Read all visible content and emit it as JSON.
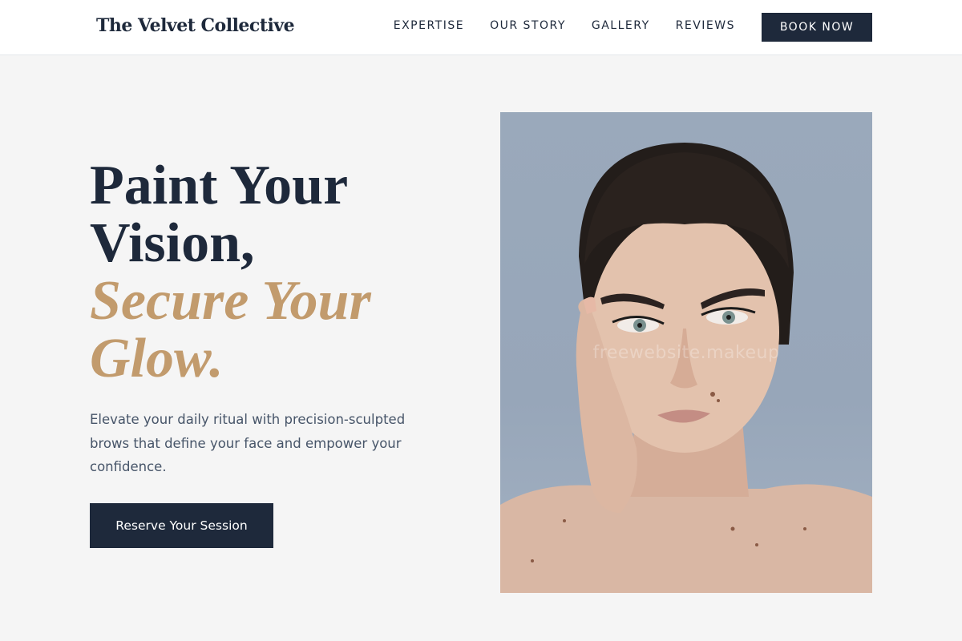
{
  "brand": "The Velvet Collective",
  "nav": {
    "items": [
      "EXPERTISE",
      "OUR STORY",
      "GALLERY",
      "REVIEWS"
    ],
    "book_label": "BOOK NOW"
  },
  "hero": {
    "title_line1": "Paint Your",
    "title_line2": "Vision,",
    "title_line3": "Secure Your",
    "title_line4": "Glow.",
    "subtitle_line1": "Elevate your daily ritual with precision-sculpted",
    "subtitle_line2": "brows that define your face and empower your",
    "subtitle_line3": "confidence.",
    "cta_label": "Reserve Your Session"
  },
  "image": {
    "watermark": "freewebsite.makeup"
  },
  "colors": {
    "primary": "#1e293b",
    "accent": "#c29b6d",
    "background": "#f5f5f5"
  }
}
